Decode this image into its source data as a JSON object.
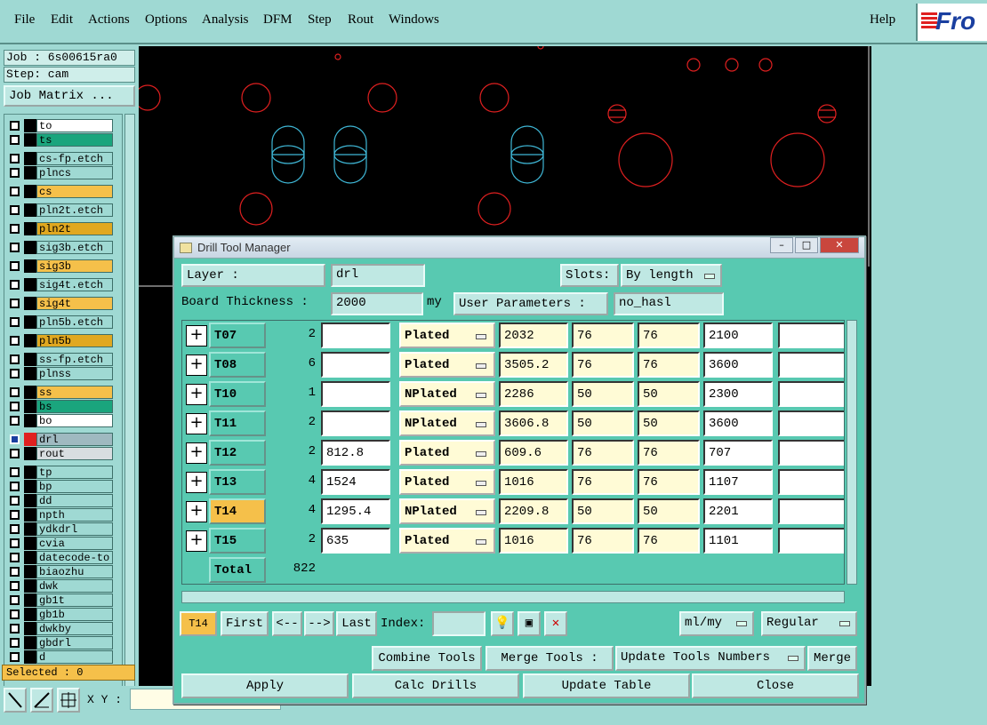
{
  "menu": {
    "items": [
      "File",
      "Edit",
      "Actions",
      "Options",
      "Analysis",
      "DFM",
      "Step",
      "Rout",
      "Windows"
    ],
    "help": "Help",
    "logo": "Fro"
  },
  "left": {
    "job": "Job : 6s00615ra0",
    "step": "Step: cam",
    "job_matrix": "Job Matrix ...",
    "selected": "Selected : 0",
    "layers": [
      {
        "name": "to",
        "color": "#ffffff"
      },
      {
        "name": "ts",
        "color": "#1aa57d"
      },
      {
        "name": "cs-fp.etch",
        "color": "#9fd9d3"
      },
      {
        "name": "plncs",
        "color": "#9fd9d3"
      },
      {
        "name": "cs",
        "color": "#f5c04a"
      },
      {
        "name": "pln2t.etch",
        "color": "#9fd9d3"
      },
      {
        "name": "pln2t",
        "color": "#e0a820"
      },
      {
        "name": "sig3b.etch",
        "color": "#9fd9d3"
      },
      {
        "name": "sig3b",
        "color": "#f5c04a"
      },
      {
        "name": "sig4t.etch",
        "color": "#9fd9d3"
      },
      {
        "name": "sig4t",
        "color": "#f5c04a"
      },
      {
        "name": "pln5b.etch",
        "color": "#9fd9d3"
      },
      {
        "name": "pln5b",
        "color": "#e0a820"
      },
      {
        "name": "ss-fp.etch",
        "color": "#9fd9d3"
      },
      {
        "name": "plnss",
        "color": "#9fd9d3"
      },
      {
        "name": "ss",
        "color": "#f5c04a"
      },
      {
        "name": "bs",
        "color": "#1aa57d"
      },
      {
        "name": "bo",
        "color": "#ffffff"
      },
      {
        "name": "drl",
        "color": "#9fb9c0"
      },
      {
        "name": "rout",
        "color": "#d8dde0"
      },
      {
        "name": "tp",
        "color": "#9fd9d3"
      },
      {
        "name": "bp",
        "color": "#9fd9d3"
      },
      {
        "name": "dd",
        "color": "#9fd9d3"
      },
      {
        "name": "npth",
        "color": "#9fd9d3"
      },
      {
        "name": "ydkdrl",
        "color": "#9fd9d3"
      },
      {
        "name": "cvia",
        "color": "#9fd9d3"
      },
      {
        "name": "datecode-to",
        "color": "#9fd9d3"
      },
      {
        "name": "biaozhu",
        "color": "#9fd9d3"
      },
      {
        "name": "dwk",
        "color": "#9fd9d3"
      },
      {
        "name": "gb1t",
        "color": "#9fd9d3"
      },
      {
        "name": "gb1b",
        "color": "#9fd9d3"
      },
      {
        "name": "dwkby",
        "color": "#9fd9d3"
      },
      {
        "name": "gbdrl",
        "color": "#9fd9d3"
      },
      {
        "name": "d",
        "color": "#9fd9d3"
      }
    ]
  },
  "bottom": {
    "xy_label": "X Y :"
  },
  "dialog": {
    "title": "Drill Tool Manager",
    "layer_label": "Layer          :",
    "layer_value": "drl",
    "slots_label": "Slots:",
    "slots_value": "By length",
    "board_label": "Board Thickness :",
    "board_value": "2000",
    "board_unit": "my",
    "user_params_label": "User Parameters :",
    "user_params_value": "no_hasl",
    "rows": [
      {
        "tool": "T07",
        "count": "2",
        "c1": "",
        "type": "Plated",
        "c3": "2032",
        "c4": "76",
        "c5": "76",
        "c6": "2100",
        "c7": ""
      },
      {
        "tool": "T08",
        "count": "6",
        "c1": "",
        "type": "Plated",
        "c3": "3505.2",
        "c4": "76",
        "c5": "76",
        "c6": "3600",
        "c7": ""
      },
      {
        "tool": "T10",
        "count": "1",
        "c1": "",
        "type": "NPlated",
        "c3": "2286",
        "c4": "50",
        "c5": "50",
        "c6": "2300",
        "c7": ""
      },
      {
        "tool": "T11",
        "count": "2",
        "c1": "",
        "type": "NPlated",
        "c3": "3606.8",
        "c4": "50",
        "c5": "50",
        "c6": "3600",
        "c7": ""
      },
      {
        "tool": "T12",
        "count": "2",
        "c1": "812.8",
        "type": "Plated",
        "c3": "609.6",
        "c4": "76",
        "c5": "76",
        "c6": "707",
        "c7": ""
      },
      {
        "tool": "T13",
        "count": "4",
        "c1": "1524",
        "type": "Plated",
        "c3": "1016",
        "c4": "76",
        "c5": "76",
        "c6": "1107",
        "c7": ""
      },
      {
        "tool": "T14",
        "count": "4",
        "c1": "1295.4",
        "type": "NPlated",
        "c3": "2209.8",
        "c4": "50",
        "c5": "50",
        "c6": "2201",
        "c7": ""
      },
      {
        "tool": "T15",
        "count": "2",
        "c1": "635",
        "type": "Plated",
        "c3": "1016",
        "c4": "76",
        "c5": "76",
        "c6": "1101",
        "c7": ""
      }
    ],
    "total_label": "Total",
    "total_value": "822",
    "current_tool": "T14",
    "nav": {
      "first": "First",
      "prev": "<--",
      "next": "-->",
      "last": "Last",
      "index_label": "Index:"
    },
    "units": "ml/my",
    "mode": "Regular",
    "combine": "Combine Tools",
    "merge_tools": "Merge Tools :",
    "update_numbers": "Update Tools Numbers",
    "merge": "Merge",
    "apply": "Apply",
    "calc": "Calc Drills",
    "update_table": "Update Table",
    "close": "Close"
  }
}
